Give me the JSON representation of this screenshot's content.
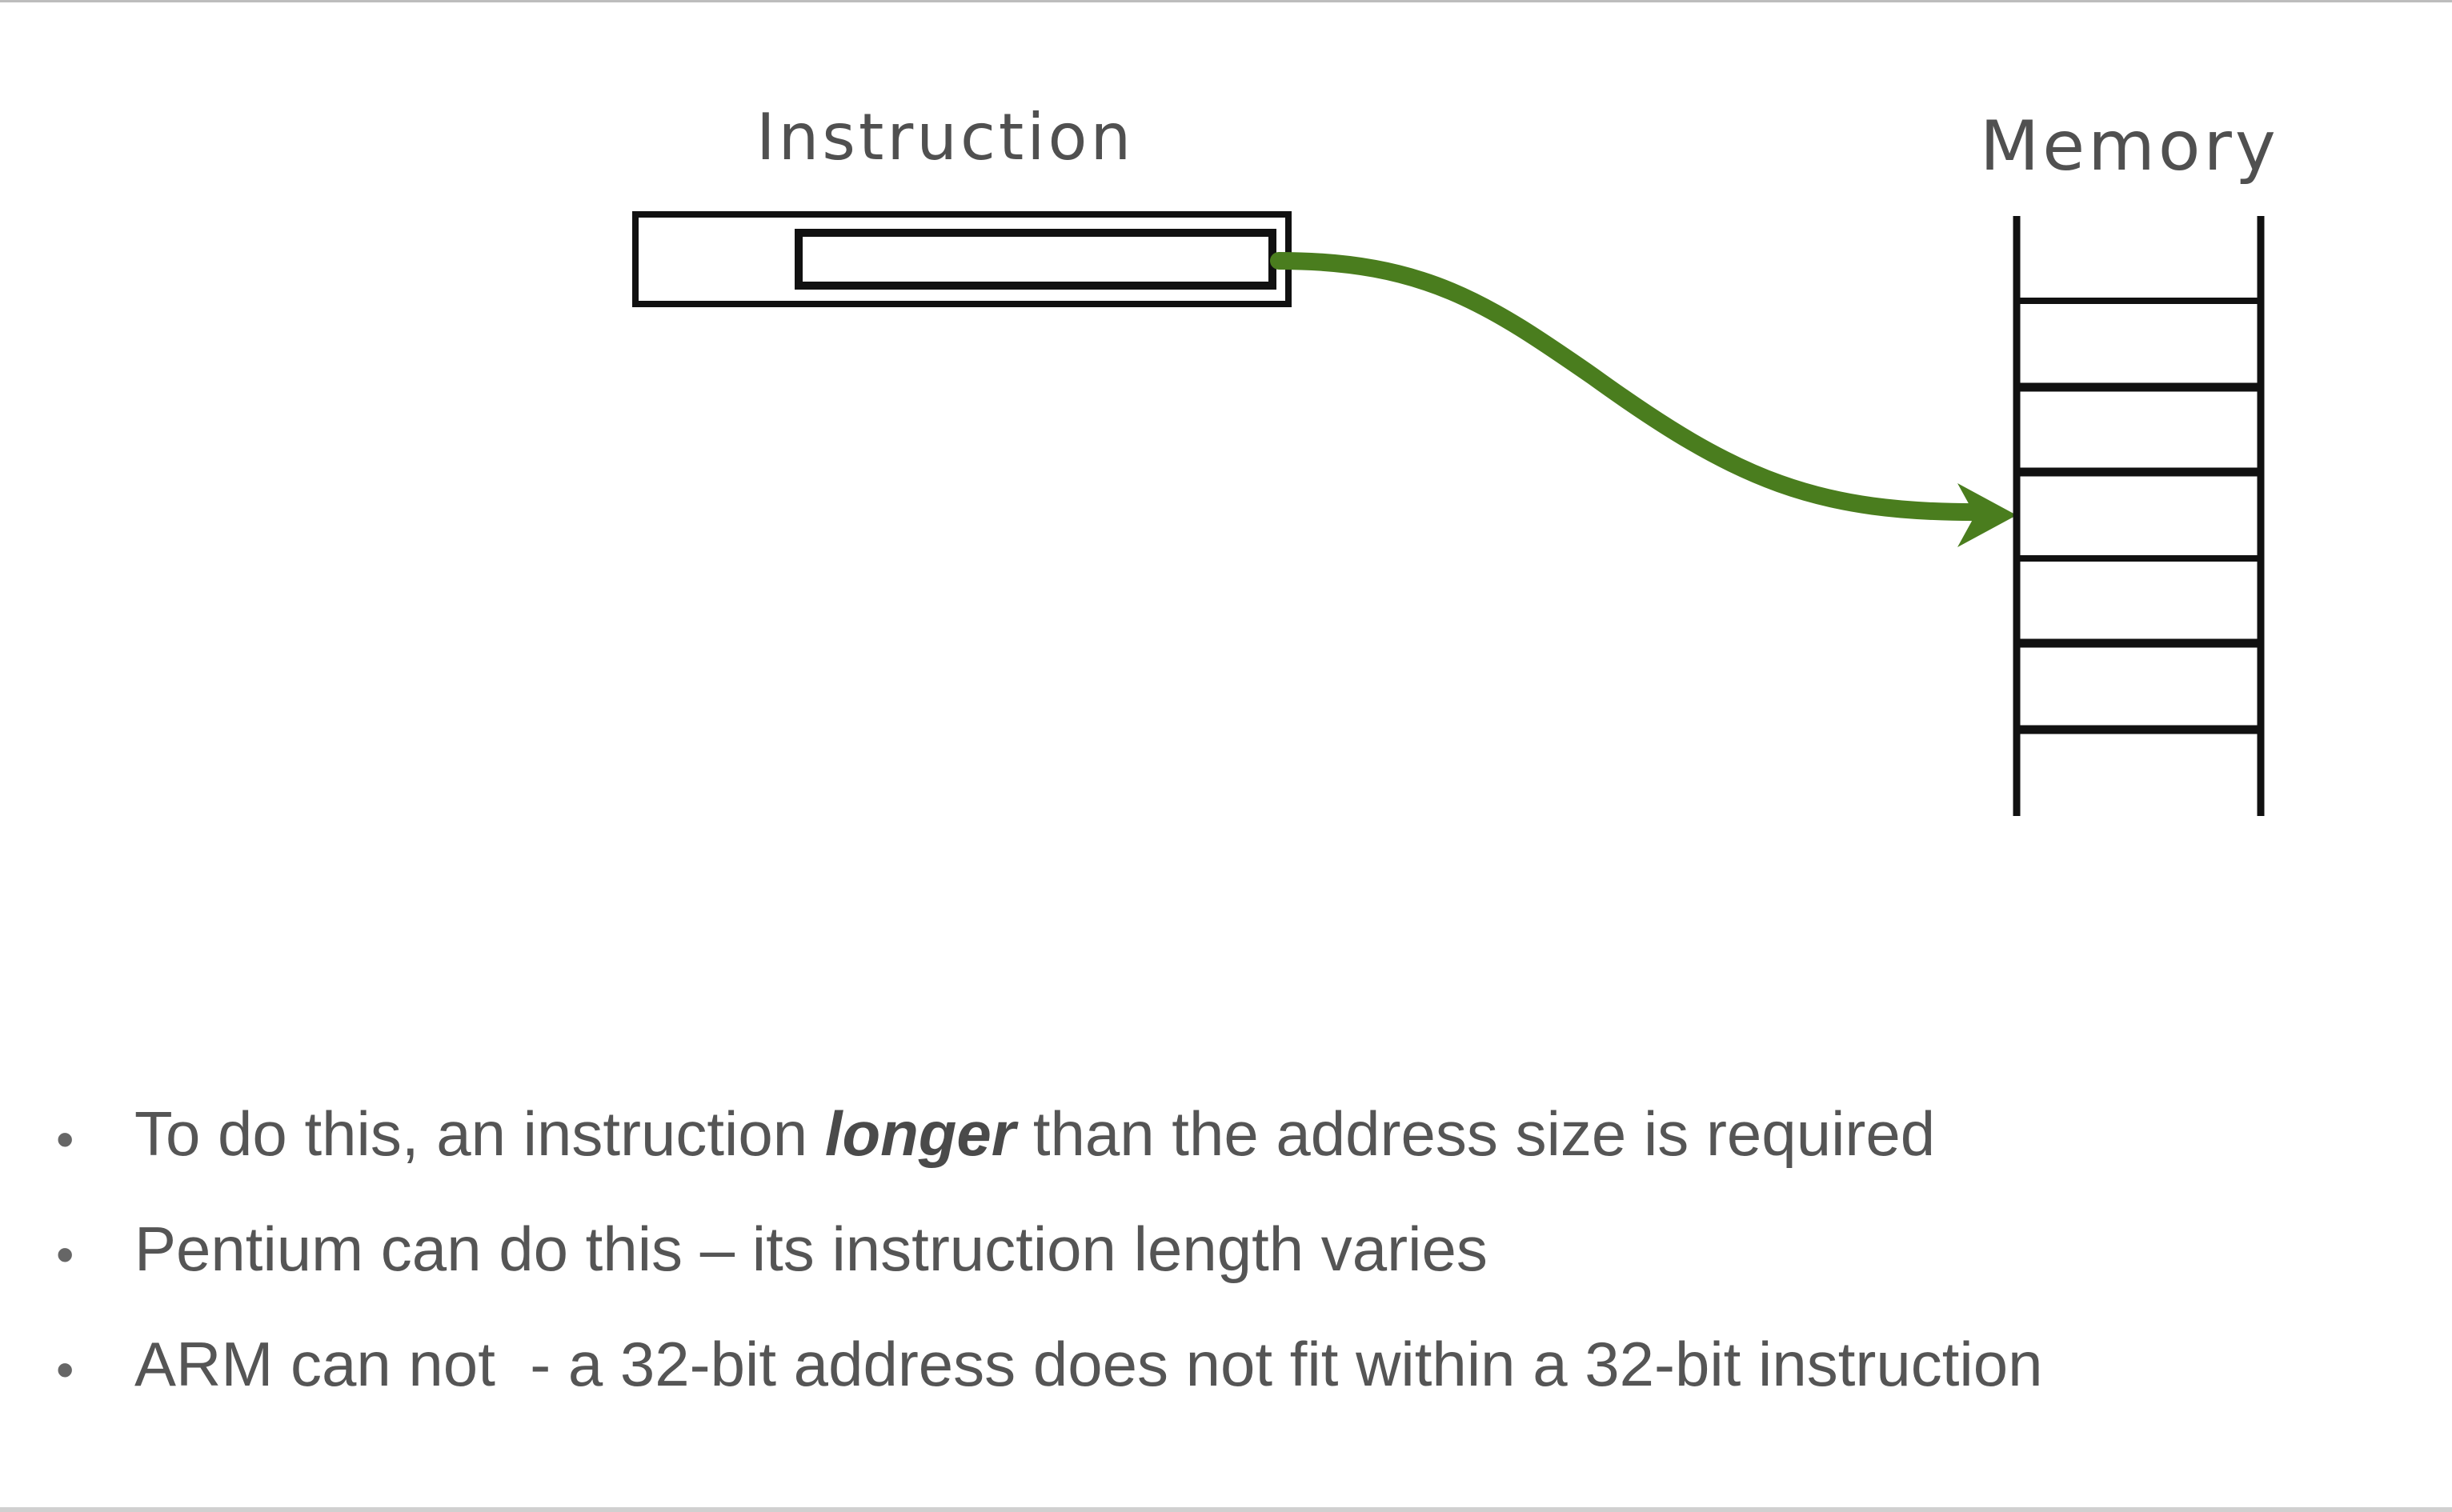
{
  "diagram": {
    "instruction_label": "Instruction",
    "memory_label": "Memory",
    "arrow_color": "#4a7d1e",
    "memory_row_count": 6
  },
  "bullets": [
    {
      "before": "To do this, an instruction ",
      "emphasis": "longer",
      "after": " than the address size is required"
    },
    {
      "text": "Pentium can do this – its instruction length varies"
    },
    {
      "text": "ARM can not  - a 32-bit address does not fit within a 32-bit instruction"
    }
  ]
}
